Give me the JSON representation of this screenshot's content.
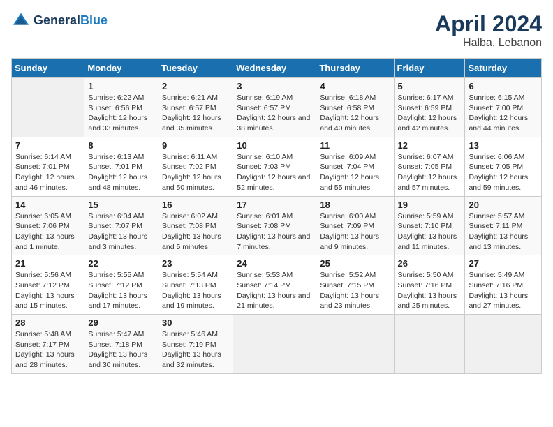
{
  "header": {
    "logo_line1": "General",
    "logo_line2": "Blue",
    "month": "April 2024",
    "location": "Halba, Lebanon"
  },
  "weekdays": [
    "Sunday",
    "Monday",
    "Tuesday",
    "Wednesday",
    "Thursday",
    "Friday",
    "Saturday"
  ],
  "weeks": [
    [
      {
        "day": "",
        "empty": true
      },
      {
        "day": "1",
        "sunrise": "6:22 AM",
        "sunset": "6:56 PM",
        "daylight": "12 hours and 33 minutes."
      },
      {
        "day": "2",
        "sunrise": "6:21 AM",
        "sunset": "6:57 PM",
        "daylight": "12 hours and 35 minutes."
      },
      {
        "day": "3",
        "sunrise": "6:19 AM",
        "sunset": "6:57 PM",
        "daylight": "12 hours and 38 minutes."
      },
      {
        "day": "4",
        "sunrise": "6:18 AM",
        "sunset": "6:58 PM",
        "daylight": "12 hours and 40 minutes."
      },
      {
        "day": "5",
        "sunrise": "6:17 AM",
        "sunset": "6:59 PM",
        "daylight": "12 hours and 42 minutes."
      },
      {
        "day": "6",
        "sunrise": "6:15 AM",
        "sunset": "7:00 PM",
        "daylight": "12 hours and 44 minutes."
      }
    ],
    [
      {
        "day": "7",
        "sunrise": "6:14 AM",
        "sunset": "7:01 PM",
        "daylight": "12 hours and 46 minutes."
      },
      {
        "day": "8",
        "sunrise": "6:13 AM",
        "sunset": "7:01 PM",
        "daylight": "12 hours and 48 minutes."
      },
      {
        "day": "9",
        "sunrise": "6:11 AM",
        "sunset": "7:02 PM",
        "daylight": "12 hours and 50 minutes."
      },
      {
        "day": "10",
        "sunrise": "6:10 AM",
        "sunset": "7:03 PM",
        "daylight": "12 hours and 52 minutes."
      },
      {
        "day": "11",
        "sunrise": "6:09 AM",
        "sunset": "7:04 PM",
        "daylight": "12 hours and 55 minutes."
      },
      {
        "day": "12",
        "sunrise": "6:07 AM",
        "sunset": "7:05 PM",
        "daylight": "12 hours and 57 minutes."
      },
      {
        "day": "13",
        "sunrise": "6:06 AM",
        "sunset": "7:05 PM",
        "daylight": "12 hours and 59 minutes."
      }
    ],
    [
      {
        "day": "14",
        "sunrise": "6:05 AM",
        "sunset": "7:06 PM",
        "daylight": "13 hours and 1 minute."
      },
      {
        "day": "15",
        "sunrise": "6:04 AM",
        "sunset": "7:07 PM",
        "daylight": "13 hours and 3 minutes."
      },
      {
        "day": "16",
        "sunrise": "6:02 AM",
        "sunset": "7:08 PM",
        "daylight": "13 hours and 5 minutes."
      },
      {
        "day": "17",
        "sunrise": "6:01 AM",
        "sunset": "7:08 PM",
        "daylight": "13 hours and 7 minutes."
      },
      {
        "day": "18",
        "sunrise": "6:00 AM",
        "sunset": "7:09 PM",
        "daylight": "13 hours and 9 minutes."
      },
      {
        "day": "19",
        "sunrise": "5:59 AM",
        "sunset": "7:10 PM",
        "daylight": "13 hours and 11 minutes."
      },
      {
        "day": "20",
        "sunrise": "5:57 AM",
        "sunset": "7:11 PM",
        "daylight": "13 hours and 13 minutes."
      }
    ],
    [
      {
        "day": "21",
        "sunrise": "5:56 AM",
        "sunset": "7:12 PM",
        "daylight": "13 hours and 15 minutes."
      },
      {
        "day": "22",
        "sunrise": "5:55 AM",
        "sunset": "7:12 PM",
        "daylight": "13 hours and 17 minutes."
      },
      {
        "day": "23",
        "sunrise": "5:54 AM",
        "sunset": "7:13 PM",
        "daylight": "13 hours and 19 minutes."
      },
      {
        "day": "24",
        "sunrise": "5:53 AM",
        "sunset": "7:14 PM",
        "daylight": "13 hours and 21 minutes."
      },
      {
        "day": "25",
        "sunrise": "5:52 AM",
        "sunset": "7:15 PM",
        "daylight": "13 hours and 23 minutes."
      },
      {
        "day": "26",
        "sunrise": "5:50 AM",
        "sunset": "7:16 PM",
        "daylight": "13 hours and 25 minutes."
      },
      {
        "day": "27",
        "sunrise": "5:49 AM",
        "sunset": "7:16 PM",
        "daylight": "13 hours and 27 minutes."
      }
    ],
    [
      {
        "day": "28",
        "sunrise": "5:48 AM",
        "sunset": "7:17 PM",
        "daylight": "13 hours and 28 minutes."
      },
      {
        "day": "29",
        "sunrise": "5:47 AM",
        "sunset": "7:18 PM",
        "daylight": "13 hours and 30 minutes."
      },
      {
        "day": "30",
        "sunrise": "5:46 AM",
        "sunset": "7:19 PM",
        "daylight": "13 hours and 32 minutes."
      },
      {
        "day": "",
        "empty": true
      },
      {
        "day": "",
        "empty": true
      },
      {
        "day": "",
        "empty": true
      },
      {
        "day": "",
        "empty": true
      }
    ]
  ]
}
